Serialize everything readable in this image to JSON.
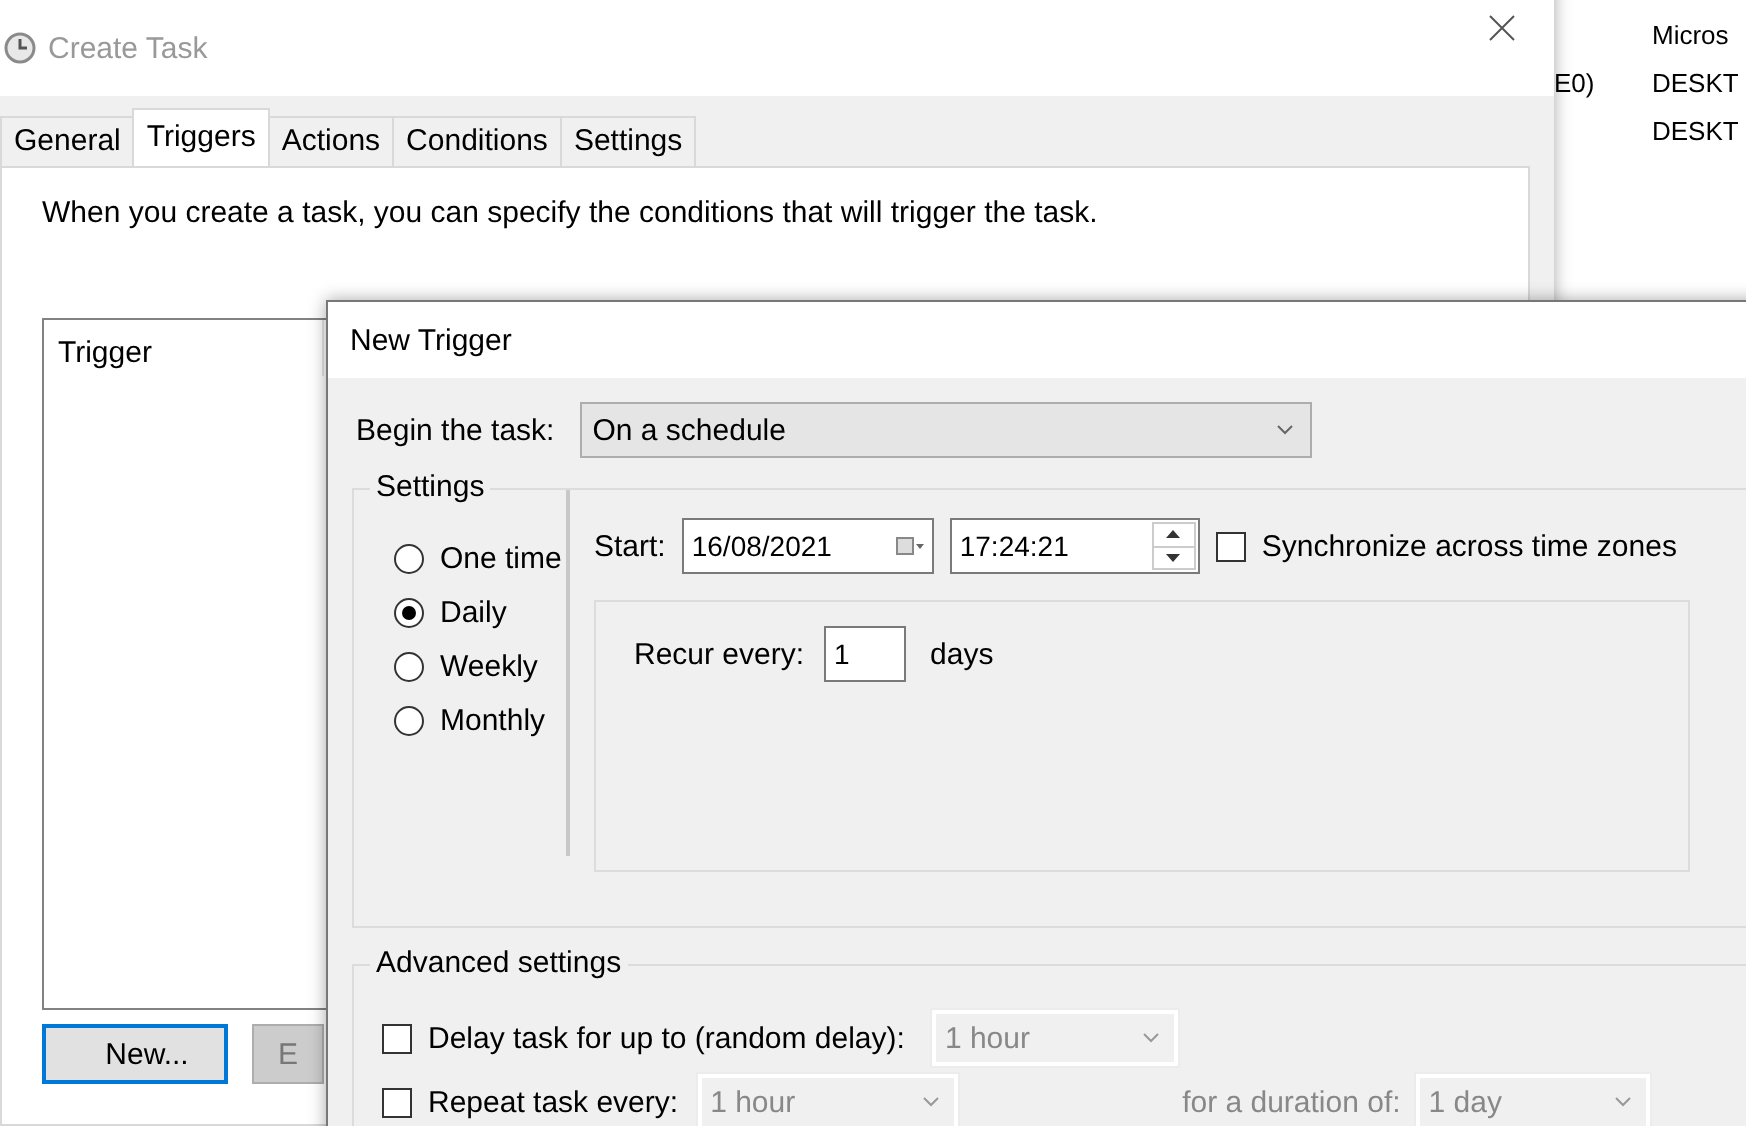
{
  "background_window": {
    "column_1": [
      "E0)"
    ],
    "column_2": [
      "Micros",
      "DESKT",
      "DESKT"
    ]
  },
  "create_task": {
    "title": "Create Task",
    "tabs": [
      {
        "label": "General",
        "selected": false
      },
      {
        "label": "Triggers",
        "selected": true
      },
      {
        "label": "Actions",
        "selected": false
      },
      {
        "label": "Conditions",
        "selected": false
      },
      {
        "label": "Settings",
        "selected": false
      }
    ],
    "description": "When you create a task, you can specify the conditions that will trigger the task.",
    "trigger_list": {
      "columns": [
        "Trigger"
      ]
    },
    "buttons": [
      {
        "label": "New...",
        "default": true
      },
      {
        "label": "E",
        "default": false
      }
    ]
  },
  "new_trigger": {
    "title": "New Trigger",
    "begin_label": "Begin the task:",
    "begin_value": "On a schedule",
    "settings_label": "Settings",
    "schedule_options": [
      {
        "label": "One time",
        "selected": false
      },
      {
        "label": "Daily",
        "selected": true
      },
      {
        "label": "Weekly",
        "selected": false
      },
      {
        "label": "Monthly",
        "selected": false
      }
    ],
    "start_label": "Start:",
    "start_date": "16/08/2021",
    "start_time": "17:24:21",
    "sync": {
      "label": "Synchronize across time zones",
      "checked": false
    },
    "recur_label": "Recur every:",
    "recur_value": "1",
    "recur_unit": "days",
    "advanced_label": "Advanced settings",
    "delay": {
      "label": "Delay task for up to (random delay):",
      "checked": false,
      "value": "1 hour"
    },
    "repeat": {
      "label": "Repeat task every:",
      "checked": false,
      "value": "1 hour"
    },
    "duration_label": "for a duration of:",
    "duration_value": "1 day"
  }
}
